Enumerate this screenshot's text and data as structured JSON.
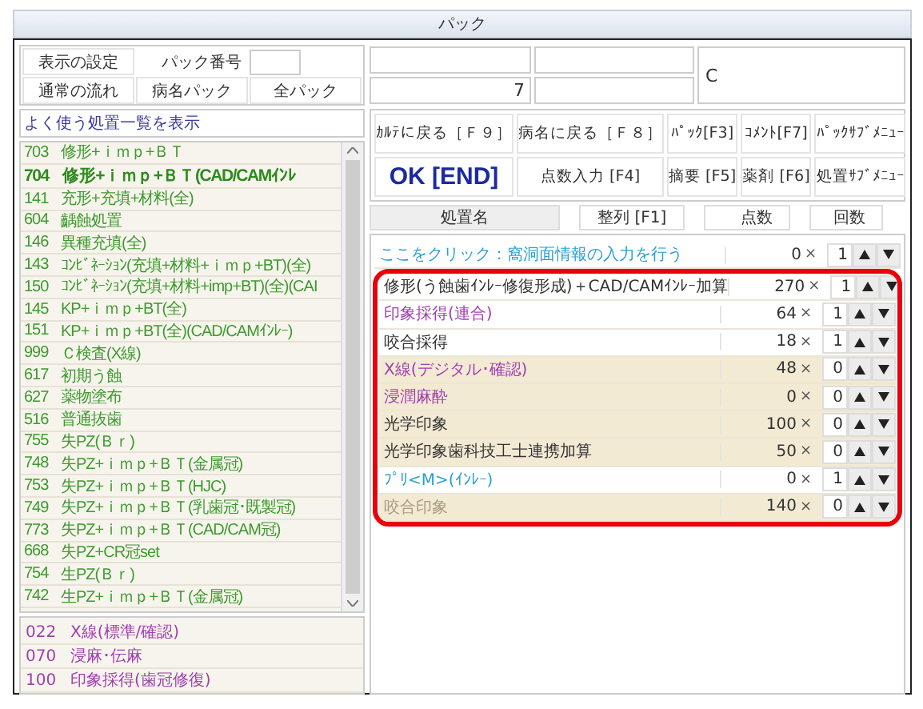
{
  "window": {
    "title": "パック"
  },
  "pack_panel": {
    "display_settings": "表示の設定",
    "pack_number_label": "パック番号",
    "normal_flow": "通常の流れ",
    "disease_pack": "病名パック",
    "all_pack": "全パック"
  },
  "top_fields": {
    "row2_value": "7",
    "large_value": "C"
  },
  "frequent_list": {
    "title": "よく使う処置一覧を表示",
    "items": [
      {
        "code": "703",
        "name": "修形+ｉｍｐ+ＢＴ",
        "selected": false
      },
      {
        "code": "704",
        "name": "修形+ｉｍｐ+ＢＴ(CAD/CAMｲﾝﾚ",
        "selected": true
      },
      {
        "code": "141",
        "name": "充形+充填+材料(全)",
        "selected": false
      },
      {
        "code": "604",
        "name": "齲蝕処置",
        "selected": false
      },
      {
        "code": "146",
        "name": "異種充填(全)",
        "selected": false
      },
      {
        "code": "143",
        "name": "ｺﾝﾋﾞﾈｰｼｮﾝ(充填+材料+ｉｍｐ+BT)(全)",
        "selected": false
      },
      {
        "code": "150",
        "name": "ｺﾝﾋﾞﾈｰｼｮﾝ(充填+材料+imp+BT)(全)(CAI",
        "selected": false
      },
      {
        "code": "145",
        "name": "KP+ｉｍｐ+BT(全)",
        "selected": false
      },
      {
        "code": "151",
        "name": "KP+ｉｍｐ+BT(全)(CAD/CAMｲﾝﾚｰ)",
        "selected": false
      },
      {
        "code": "999",
        "name": "Ｃ検査(X線)",
        "selected": false
      },
      {
        "code": "617",
        "name": "初期う蝕",
        "selected": false
      },
      {
        "code": "627",
        "name": "薬物塗布",
        "selected": false
      },
      {
        "code": "516",
        "name": "普通抜歯",
        "selected": false
      },
      {
        "code": "755",
        "name": "失PZ(Ｂｒ)",
        "selected": false
      },
      {
        "code": "748",
        "name": "失PZ+ｉｍｐ+ＢＴ(金属冠)",
        "selected": false
      },
      {
        "code": "753",
        "name": "失PZ+ｉｍｐ+ＢＴ(HJC)",
        "selected": false
      },
      {
        "code": "749",
        "name": "失PZ+ｉｍｐ+ＢＴ(乳歯冠･既製冠)",
        "selected": false
      },
      {
        "code": "773",
        "name": "失PZ+ｉｍｐ+ＢＴ(CAD/CAM冠)",
        "selected": false
      },
      {
        "code": "668",
        "name": "失PZ+CR冠set",
        "selected": false
      },
      {
        "code": "754",
        "name": "生PZ(Ｂｒ)",
        "selected": false
      },
      {
        "code": "742",
        "name": "生PZ+ｉｍｐ+ＢＴ(金属冠)",
        "selected": false
      }
    ]
  },
  "sub_list": {
    "items": [
      {
        "code": "022",
        "name": "X線(標準/確認)"
      },
      {
        "code": "070",
        "name": "浸麻･伝麻"
      },
      {
        "code": "100",
        "name": "印象採得(歯冠修復)"
      }
    ]
  },
  "function_buttons": [
    {
      "label": "ｶﾙﾃに戻る［Ｆ９］",
      "kind": "normal"
    },
    {
      "label": "病名に戻る［Ｆ８］",
      "kind": "normal"
    },
    {
      "label": "ﾊﾟｯｸ[F3]",
      "kind": "normal"
    },
    {
      "label": "ｺﾒﾝﾄ[F7]",
      "kind": "normal"
    },
    {
      "label": "ﾊﾟｯｸｻﾌﾞﾒﾆｭｰ",
      "kind": "normal"
    },
    {
      "label": "OK [END]",
      "kind": "primary"
    },
    {
      "label": "点数入力 [F4]",
      "kind": "normal"
    },
    {
      "label": "摘要 [F5]",
      "kind": "normal"
    },
    {
      "label": "薬剤 [F6]",
      "kind": "normal"
    },
    {
      "label": "処置ｻﾌﾞﾒﾆｭｰ",
      "kind": "normal"
    }
  ],
  "table": {
    "columns": [
      "処置名",
      "整列 [F1]",
      "点数",
      "回数"
    ],
    "link_row": {
      "text": "ここをクリック：窩洞面情報の入力を行う",
      "points": "0",
      "multiplier": "×",
      "times": "1"
    },
    "rows": [
      {
        "name": "修形(う蝕歯ｲﾝﾚｰ修復形成)＋CAD/CAMｲﾝﾚｰ加算",
        "points": "270",
        "multiplier": "×",
        "times": "1",
        "color": "#333333",
        "shaded": false
      },
      {
        "name": "印象採得(連合)",
        "points": "64",
        "multiplier": "×",
        "times": "1",
        "color": "#a040b0",
        "shaded": false
      },
      {
        "name": "咬合採得",
        "points": "18",
        "multiplier": "×",
        "times": "1",
        "color": "#333333",
        "shaded": false
      },
      {
        "name": "X線(デジタル･確認)",
        "points": "48",
        "multiplier": "×",
        "times": "0",
        "color": "#a040b0",
        "shaded": true
      },
      {
        "name": "浸潤麻酔",
        "points": "0",
        "multiplier": "×",
        "times": "0",
        "color": "#a040b0",
        "shaded": true
      },
      {
        "name": "光学印象",
        "points": "100",
        "multiplier": "×",
        "times": "0",
        "color": "#333333",
        "shaded": true
      },
      {
        "name": "光学印象歯科技工士連携加算",
        "points": "50",
        "multiplier": "×",
        "times": "0",
        "color": "#333333",
        "shaded": true
      },
      {
        "name": "ﾌﾟﾘ<M>(ｲﾝﾚｰ)",
        "points": "0",
        "multiplier": "×",
        "times": "1",
        "color": "#2a9fd0",
        "shaded": false
      },
      {
        "name": "咬合印象",
        "points": "140",
        "multiplier": "×",
        "times": "0",
        "color": "#a89c80",
        "shaded": true
      }
    ]
  }
}
